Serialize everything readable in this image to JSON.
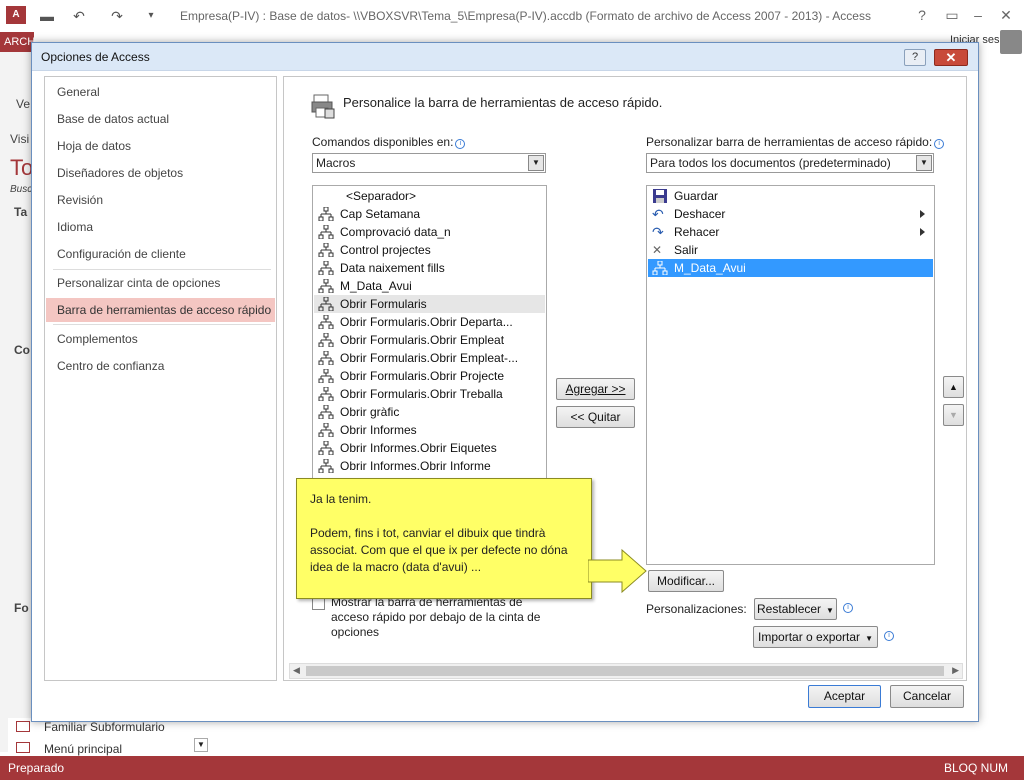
{
  "window": {
    "app_icon_text": "A",
    "title": "Empresa(P-IV) : Base de datos- \\\\VBOXSVR\\Tema_5\\Empresa(P-IV).accdb (Formato de archivo de Access 2007 - 2013) - Access",
    "help": "?",
    "archivo_tab": "ARCHIVO",
    "signin": "Iniciar sesión"
  },
  "background_nav": {
    "items": [
      "Ve",
      "Visi",
      "To",
      "Busc",
      "Ta",
      "Co",
      "Fo"
    ],
    "bottom_items": [
      "Familiar Subformulario",
      "Menú principal"
    ]
  },
  "dialog": {
    "title": "Opciones de Access",
    "help_btn": "?",
    "close_btn": "✕",
    "nav": [
      {
        "label": "General"
      },
      {
        "label": "Base de datos actual"
      },
      {
        "label": "Hoja de datos"
      },
      {
        "label": "Diseñadores de objetos"
      },
      {
        "label": "Revisión"
      },
      {
        "label": "Idioma"
      },
      {
        "label": "Configuración de cliente"
      },
      {
        "label": "Personalizar cinta de opciones"
      },
      {
        "label": "Barra de herramientas de acceso rápido"
      },
      {
        "label": "Complementos"
      },
      {
        "label": "Centro de confianza"
      }
    ],
    "heading": "Personalice la barra de herramientas de acceso rápido.",
    "commands_label": "Comandos disponibles en:",
    "commands_value": "Macros",
    "customize_label": "Personalizar barra de herramientas de acceso rápido:",
    "customize_value": "Para todos los documentos (predeterminado)",
    "left_list": [
      "<Separador>",
      "Cap Setamana",
      "Comprovació data_n",
      "Control projectes",
      "Data naixement fills",
      "M_Data_Avui",
      "Obrir Formularis",
      "Obrir Formularis.Obrir Departa...",
      "Obrir Formularis.Obrir Empleat",
      "Obrir Formularis.Obrir Empleat-...",
      "Obrir Formularis.Obrir Projecte",
      "Obrir Formularis.Obrir Treballa",
      "Obrir gràfic",
      "Obrir Informes",
      "Obrir Informes.Obrir Eiquetes",
      "Obrir Informes.Obrir Informe"
    ],
    "right_list": [
      {
        "label": "Guardar",
        "icon": "save-icon"
      },
      {
        "label": "Deshacer",
        "icon": "undo-icon"
      },
      {
        "label": "Rehacer",
        "icon": "redo-icon"
      },
      {
        "label": "Salir",
        "icon": "close-icon"
      },
      {
        "label": "M_Data_Avui",
        "icon": "macro-icon"
      }
    ],
    "add_btn": "Agregar >>",
    "remove_btn": "<< Quitar",
    "modify_btn": "Modificar...",
    "show_below_label": "Mostrar la barra de herramientas de acceso rápido por debajo de la cinta de opciones",
    "customizations_label": "Personalizaciones:",
    "reset_btn": "Restablecer",
    "import_btn": "Importar o exportar",
    "ok_btn": "Aceptar",
    "cancel_btn": "Cancelar"
  },
  "callout": {
    "line1": "Ja la tenim.",
    "line2": "Podem, fins i tot, canviar el dibuix que tindrà associat. Com que el que ix per defecte no dóna idea de la macro (data d'avui) ..."
  },
  "status": {
    "left": "Preparado",
    "right": "BLOQ NUM"
  },
  "colors": {
    "accent": "#a4373a",
    "selection": "#3399ff",
    "nav_selected": "#f4c6c2",
    "callout": "#ffff66"
  }
}
